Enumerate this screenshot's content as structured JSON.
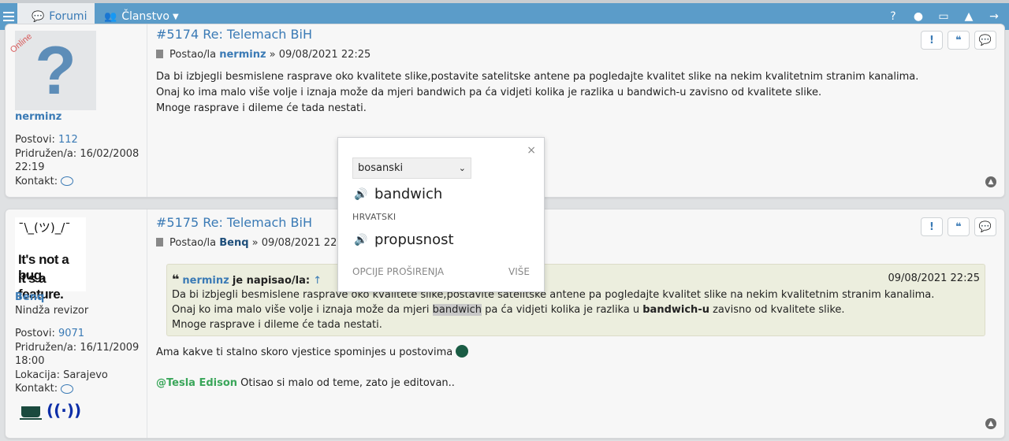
{
  "nav": {
    "forumi": "Forumi",
    "clanstvo": "Članstvo"
  },
  "posts": [
    {
      "online": "Online",
      "username": "nerminz",
      "stats": {
        "postovi_label": "Postovi:",
        "postovi": "112",
        "pridruzen": "Pridružen/a: 16/02/2008 22:19",
        "kontakt_label": "Kontakt:"
      },
      "title": "#5174 Re: Telemach BiH",
      "meta_prefix": "Postao/la",
      "meta_user": "nerminz",
      "meta_date": "» 09/08/2021 22:25",
      "body": [
        "Da bi izbjegli besmislene rasprave oko kvalitete slike,postavite satelitske antene pa pogledajte kvalitet slike na nekim kvalitetnim stranim kanalima.",
        "Onaj ko ima malo više volje i iznaja može da mjeri bandwich pa ća vidjeti kolika je razlika u bandwich-u zavisno od kvalitete slike.",
        "Mnoge rasprave i dileme će tada nestati."
      ]
    },
    {
      "avatar_shrug": "¯\\_(ツ)_/¯",
      "avatar_line1": "It's not a bug,",
      "avatar_line2": "it's a feature.",
      "username": "Benq",
      "rank": "Nindža revizor",
      "stats": {
        "postovi_label": "Postovi:",
        "postovi": "9071",
        "pridruzen": "Pridružen/a: 16/11/2009 18:00",
        "lokacija": "Lokacija: Sarajevo",
        "kontakt_label": "Kontakt:"
      },
      "title": "#5175 Re: Telemach BiH",
      "meta_prefix": "Postao/la",
      "meta_user": "Benq",
      "meta_date": "» 09/08/2021 22:25",
      "quote": {
        "user": "nerminz",
        "says": "je napisao/la:",
        "arrow": "↑",
        "date": "09/08/2021 22:25",
        "line1": "Da bi izbjegli besmislene rasprave oko kvalitete slike,postavite satelitske antene pa pogledajte kvalitet slike na nekim kvalitetnim stranim kanalima.",
        "line2_a": "Onaj ko ima malo više volje i iznaja može da mjeri",
        "line2_hl": "bandwich",
        "line2_b": "pa ća vidjeti kolika je razlika u",
        "line2_bold": "bandwich-u",
        "line2_c": "zavisno od kvalitete slike.",
        "line3": "Mnoge rasprave i dileme će tada nestati."
      },
      "reply": "Ama kakve ti stalno skoro vjestice spominjes u postovima",
      "mention": "@Tesla Edison",
      "mention_msg": "Otisao si malo od teme, zato je editovan.."
    }
  ],
  "popup": {
    "select": "bosanski",
    "source_word": "bandwich",
    "target_lang": "HRVATSKI",
    "target_word": "propusnost",
    "footer_left": "OPCIJE PROŠIRENJA",
    "footer_right": "VIŠE",
    "close": "×"
  }
}
